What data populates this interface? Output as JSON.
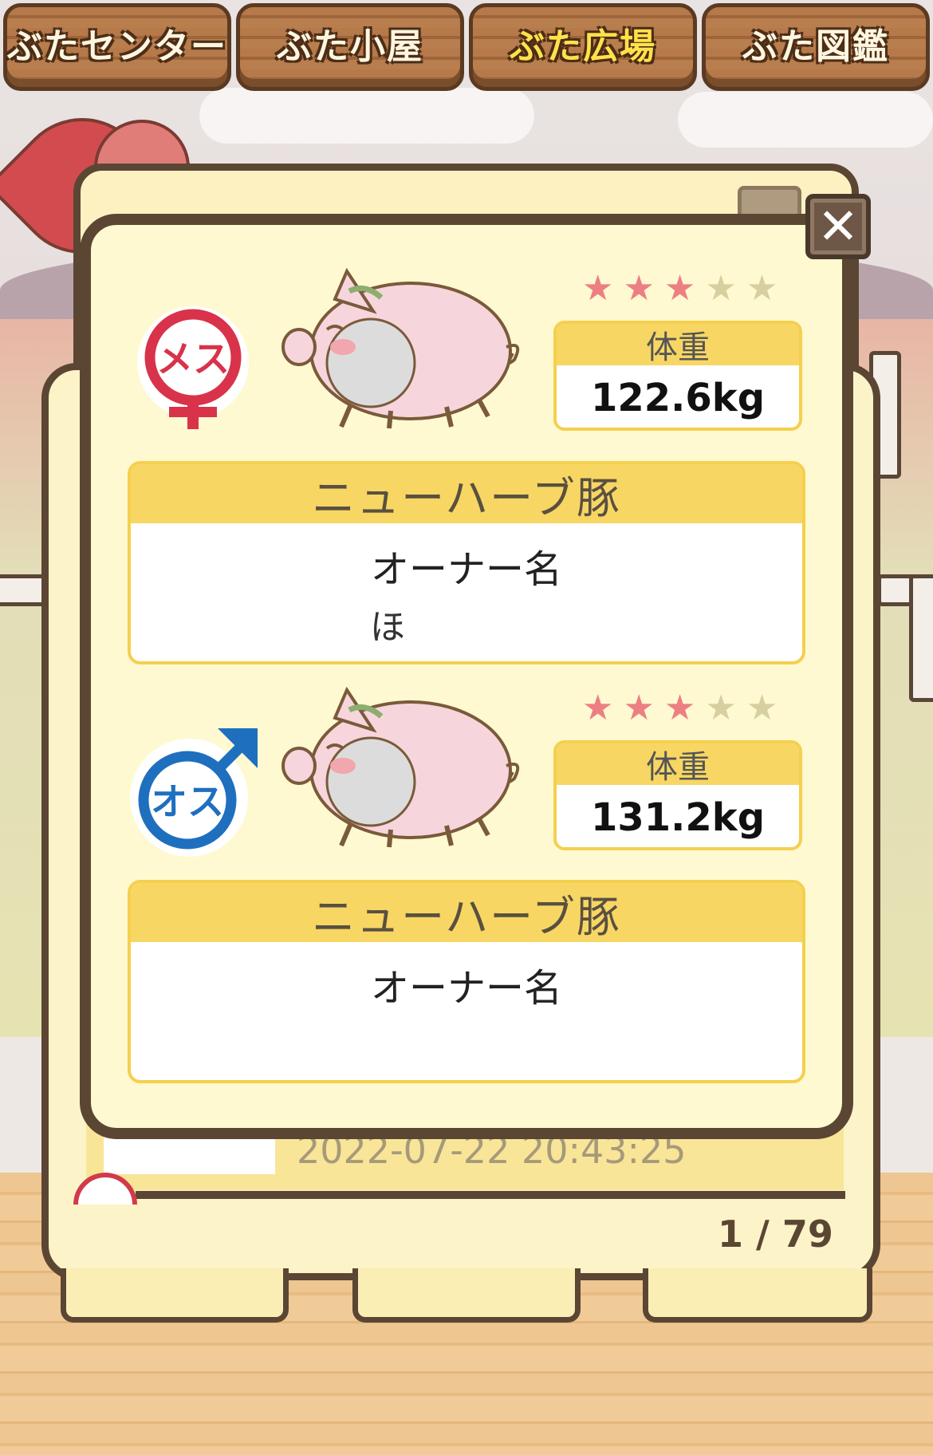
{
  "tabs": [
    {
      "label": "ぶたセンター",
      "active": false
    },
    {
      "label": "ぶた小屋",
      "active": false
    },
    {
      "label": "ぶた広場",
      "active": true
    },
    {
      "label": "ぶた図鑑",
      "active": false
    }
  ],
  "background": {
    "date_text": "2022-07-22 20:43:25",
    "page_counter": "1 / 79"
  },
  "modal": {
    "close_symbol": "✕",
    "female": {
      "gender_label": "メス",
      "stars_filled": 3,
      "stars_total": 5,
      "weight_header": "体重",
      "weight_value": "122.6kg",
      "breed": "ニューハーブ豚",
      "owner_label": "オーナー名",
      "owner_name": "ほ"
    },
    "male": {
      "gender_label": "オス",
      "stars_filled": 3,
      "stars_total": 5,
      "weight_header": "体重",
      "weight_value": "131.2kg",
      "breed": "ニューハーブ豚",
      "owner_label": "オーナー名",
      "owner_name": ""
    }
  },
  "colors": {
    "female": "#d8334a",
    "male": "#1f6fbf",
    "star_on": "#ec7f84",
    "star_off": "#d8cfa0",
    "header_yellow": "#f7d663",
    "frame_brown": "#5b4634"
  }
}
